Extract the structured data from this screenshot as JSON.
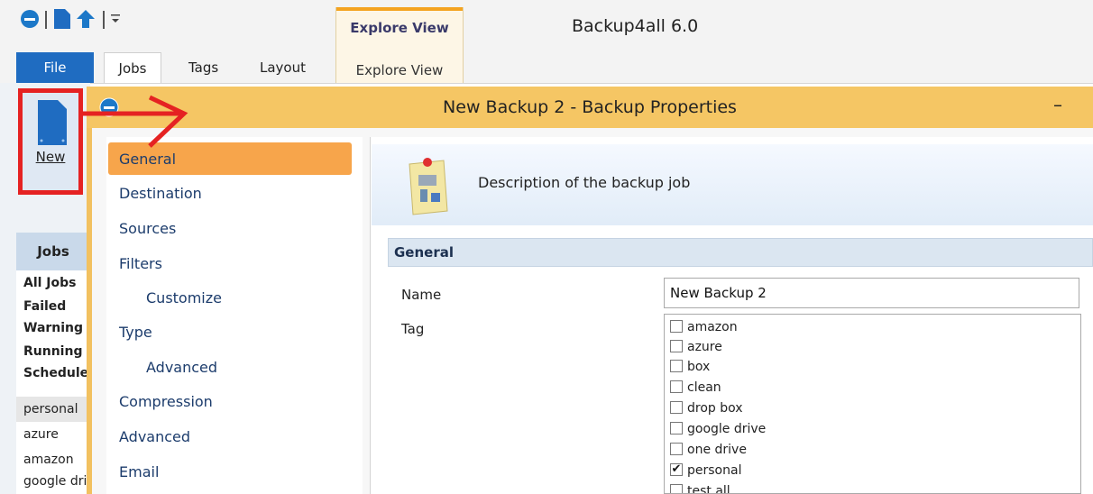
{
  "app_title": "Backup4all 6.0",
  "ribbon": {
    "file_label": "File",
    "tabs": [
      "Jobs",
      "Tags",
      "Layout"
    ],
    "context_group": "Explore View",
    "context_tab": "Explore View",
    "new_label": "New"
  },
  "dialog": {
    "title": "New Backup 2 - Backup Properties",
    "minimize_glyph": "–"
  },
  "jobs_panel": {
    "header": "Jobs",
    "items": [
      "All Jobs",
      "Failed",
      "Warning",
      "Running",
      "Scheduled",
      "personal",
      "azure",
      "amazon",
      "google drive"
    ]
  },
  "nav": {
    "items": [
      "General",
      "Destination",
      "Sources",
      "Filters",
      "Customize",
      "Type",
      "Advanced",
      "Compression",
      "Advanced",
      "Email"
    ],
    "selected": "General"
  },
  "content": {
    "description": "Description of the backup job",
    "section": "General",
    "name_label": "Name",
    "name_value": "New Backup 2",
    "tag_label": "Tag",
    "tags": [
      {
        "label": "amazon",
        "checked": false
      },
      {
        "label": "azure",
        "checked": false
      },
      {
        "label": "box",
        "checked": false
      },
      {
        "label": "clean",
        "checked": false
      },
      {
        "label": "drop box",
        "checked": false
      },
      {
        "label": "google drive",
        "checked": false
      },
      {
        "label": "one drive",
        "checked": false
      },
      {
        "label": "personal",
        "checked": true
      },
      {
        "label": "test all",
        "checked": false
      }
    ]
  },
  "colors": {
    "accent_orange": "#f7a54b",
    "title_gold": "#f5c664",
    "file_blue": "#1f6cc1",
    "annotation_red": "#e52222"
  }
}
